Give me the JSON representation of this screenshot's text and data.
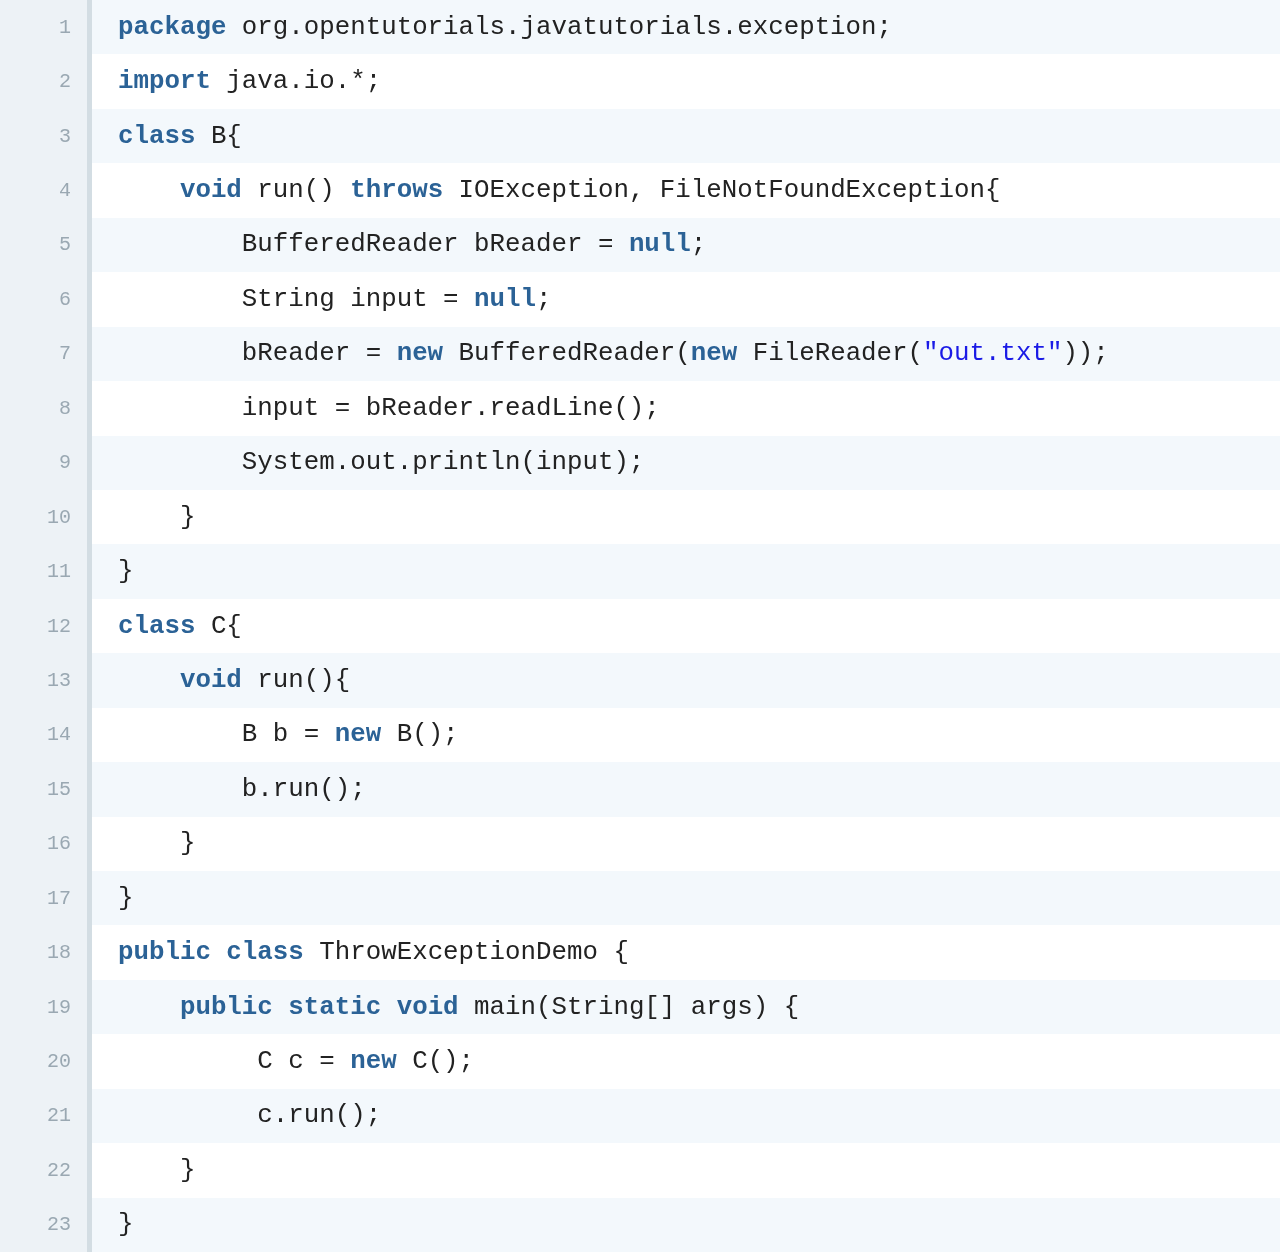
{
  "code_lines": [
    {
      "number": "1",
      "tokens": [
        {
          "kind": "keyword",
          "text": "package"
        },
        {
          "kind": "plain",
          "text": " org.opentutorials.javatutorials.exception;"
        }
      ]
    },
    {
      "number": "2",
      "tokens": [
        {
          "kind": "keyword",
          "text": "import"
        },
        {
          "kind": "plain",
          "text": " java.io.*;"
        }
      ]
    },
    {
      "number": "3",
      "tokens": [
        {
          "kind": "keyword",
          "text": "class"
        },
        {
          "kind": "plain",
          "text": " B{"
        }
      ]
    },
    {
      "number": "4",
      "tokens": [
        {
          "kind": "keyword",
          "text": "    void"
        },
        {
          "kind": "plain",
          "text": " run() "
        },
        {
          "kind": "keyword",
          "text": "throws"
        },
        {
          "kind": "plain",
          "text": " IOException, FileNotFoundException{"
        }
      ]
    },
    {
      "number": "5",
      "tokens": [
        {
          "kind": "plain",
          "text": "        BufferedReader bReader = "
        },
        {
          "kind": "keyword",
          "text": "null"
        },
        {
          "kind": "plain",
          "text": ";"
        }
      ]
    },
    {
      "number": "6",
      "tokens": [
        {
          "kind": "plain",
          "text": "        String input = "
        },
        {
          "kind": "keyword",
          "text": "null"
        },
        {
          "kind": "plain",
          "text": ";"
        }
      ]
    },
    {
      "number": "7",
      "tokens": [
        {
          "kind": "plain",
          "text": "        bReader = "
        },
        {
          "kind": "keyword",
          "text": "new"
        },
        {
          "kind": "plain",
          "text": " BufferedReader("
        },
        {
          "kind": "keyword",
          "text": "new"
        },
        {
          "kind": "plain",
          "text": " FileReader("
        },
        {
          "kind": "string",
          "text": "\"out.txt\""
        },
        {
          "kind": "plain",
          "text": "));"
        }
      ]
    },
    {
      "number": "8",
      "tokens": [
        {
          "kind": "plain",
          "text": "        input = bReader.readLine();"
        }
      ]
    },
    {
      "number": "9",
      "tokens": [
        {
          "kind": "plain",
          "text": "        System.out.println(input);"
        }
      ]
    },
    {
      "number": "10",
      "tokens": [
        {
          "kind": "plain",
          "text": "    }"
        }
      ]
    },
    {
      "number": "11",
      "tokens": [
        {
          "kind": "plain",
          "text": "}"
        }
      ]
    },
    {
      "number": "12",
      "tokens": [
        {
          "kind": "keyword",
          "text": "class"
        },
        {
          "kind": "plain",
          "text": " C{"
        }
      ]
    },
    {
      "number": "13",
      "tokens": [
        {
          "kind": "keyword",
          "text": "    void"
        },
        {
          "kind": "plain",
          "text": " run(){"
        }
      ]
    },
    {
      "number": "14",
      "tokens": [
        {
          "kind": "plain",
          "text": "        B b = "
        },
        {
          "kind": "keyword",
          "text": "new"
        },
        {
          "kind": "plain",
          "text": " B();"
        }
      ]
    },
    {
      "number": "15",
      "tokens": [
        {
          "kind": "plain",
          "text": "        b.run();"
        }
      ]
    },
    {
      "number": "16",
      "tokens": [
        {
          "kind": "plain",
          "text": "    }"
        }
      ]
    },
    {
      "number": "17",
      "tokens": [
        {
          "kind": "plain",
          "text": "}"
        }
      ]
    },
    {
      "number": "18",
      "tokens": [
        {
          "kind": "keyword",
          "text": "public"
        },
        {
          "kind": "keyword",
          "text": " class"
        },
        {
          "kind": "plain",
          "text": " ThrowExceptionDemo {"
        }
      ]
    },
    {
      "number": "19",
      "tokens": [
        {
          "kind": "keyword",
          "text": "    public"
        },
        {
          "kind": "keyword",
          "text": " static"
        },
        {
          "kind": "keyword",
          "text": " void"
        },
        {
          "kind": "plain",
          "text": " main(String[] args) {"
        }
      ]
    },
    {
      "number": "20",
      "tokens": [
        {
          "kind": "plain",
          "text": "         C c = "
        },
        {
          "kind": "keyword",
          "text": "new"
        },
        {
          "kind": "plain",
          "text": " C();"
        }
      ]
    },
    {
      "number": "21",
      "tokens": [
        {
          "kind": "plain",
          "text": "         c.run();"
        }
      ]
    },
    {
      "number": "22",
      "tokens": [
        {
          "kind": "plain",
          "text": "    }"
        }
      ]
    },
    {
      "number": "23",
      "tokens": [
        {
          "kind": "plain",
          "text": "}"
        }
      ]
    }
  ]
}
